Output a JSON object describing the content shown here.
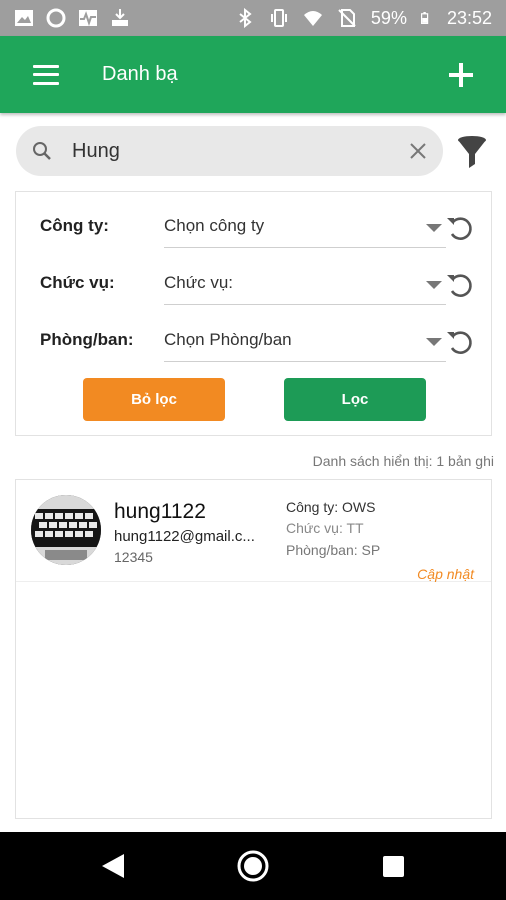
{
  "status_bar": {
    "battery": "59%",
    "time": "23:52"
  },
  "app_bar": {
    "title": "Danh bạ"
  },
  "search": {
    "value": "Hung"
  },
  "filters": {
    "company": {
      "label": "Công ty:",
      "value": "Chọn công ty"
    },
    "position": {
      "label": "Chức vụ:",
      "value": "Chức vụ:"
    },
    "department": {
      "label": "Phòng/ban:",
      "value": "Chọn Phòng/ban"
    },
    "clear_button": "Bỏ lọc",
    "apply_button": "Lọc"
  },
  "results_count": "Danh sách hiển thị: 1 bản ghi",
  "results": [
    {
      "name": "hung1122",
      "email": "hung1122@gmail.c...",
      "phone": "12345",
      "company": "Công ty: OWS",
      "position": "Chức vụ: TT",
      "department": "Phòng/ban: SP",
      "action": "Cập nhật"
    }
  ],
  "colors": {
    "primary": "#1fa65a",
    "accent": "#f28a22",
    "status_bar": "#9e9e9e"
  },
  "icons": [
    "image-icon",
    "circle-icon",
    "pulse-icon",
    "download-icon",
    "bluetooth-icon",
    "vibrate-icon",
    "wifi-icon",
    "no-sim-icon",
    "battery-icon",
    "menu-icon",
    "add-icon",
    "search-icon",
    "clear-icon",
    "filter-icon",
    "reset-icon",
    "back-icon",
    "home-icon",
    "recents-icon"
  ]
}
